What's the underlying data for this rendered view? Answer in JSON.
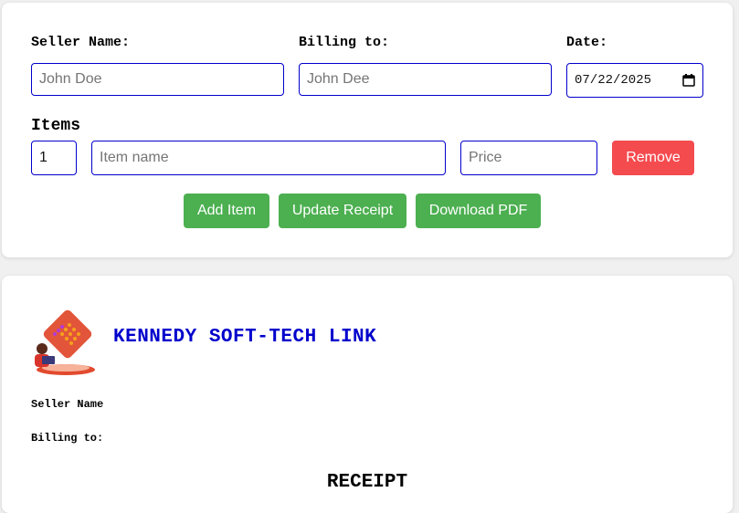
{
  "form": {
    "seller_label": "Seller Name:",
    "seller_placeholder": "John Doe",
    "billing_label": "Billing to:",
    "billing_placeholder": "John Dee",
    "date_label": "Date:",
    "date_value": "07/22/2025",
    "calendar_icon": "calendar-icon",
    "items_label": "Items",
    "item": {
      "quantity": "1",
      "name_placeholder": "Item name",
      "price_placeholder": "Price",
      "remove_label": "Remove"
    },
    "buttons": {
      "add_item": "Add Item",
      "update_receipt": "Update Receipt",
      "download_pdf": "Download PDF"
    }
  },
  "receipt": {
    "company_name": "KENNEDY SOFT-TECH LINK",
    "seller_label": "Seller Name",
    "billing_label": "Billing to:",
    "title": "RECEIPT"
  },
  "colors": {
    "accent_blue": "#0000cc",
    "button_green": "#4caf50",
    "button_red": "#f44b4f"
  }
}
